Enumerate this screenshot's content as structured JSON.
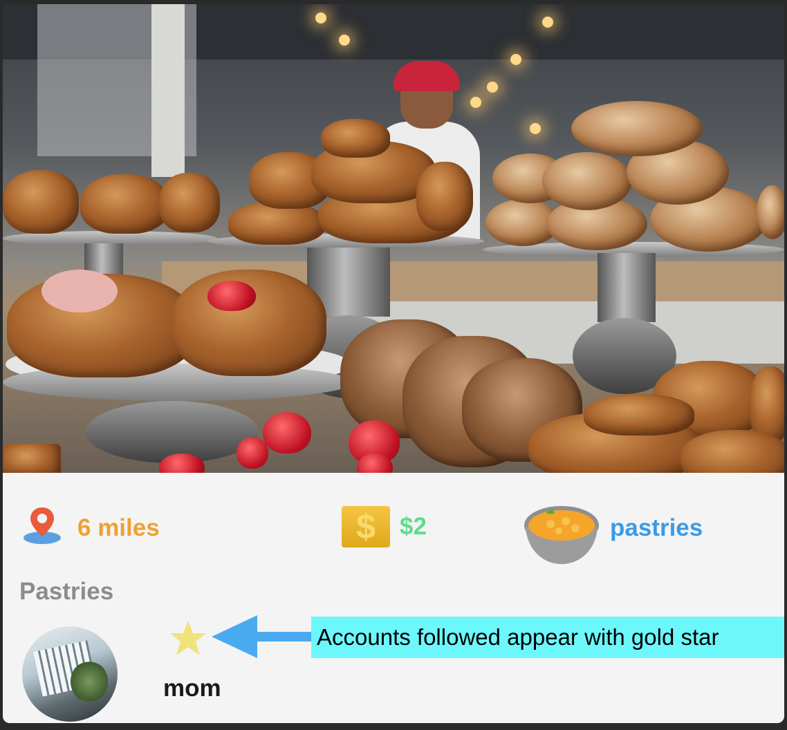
{
  "listing": {
    "distance": "6 miles",
    "price": "$2",
    "category": "pastries",
    "section_title": "Pastries"
  },
  "account": {
    "username": "mom"
  },
  "annotation": {
    "callout_text": "Accounts followed appear with gold star"
  },
  "icons": {
    "distance": "map-pin-icon",
    "price": "dollar-icon",
    "category": "bowl-icon",
    "followed": "star-icon",
    "pointer": "arrow-left-icon"
  },
  "colors": {
    "distance": "#f0a033",
    "price": "#5ddc8e",
    "category": "#3a9be8",
    "section_title": "#8c8c8c",
    "star": "#f2e27a",
    "callout_bg": "#6cf7fb",
    "arrow": "#4aaaf0"
  }
}
